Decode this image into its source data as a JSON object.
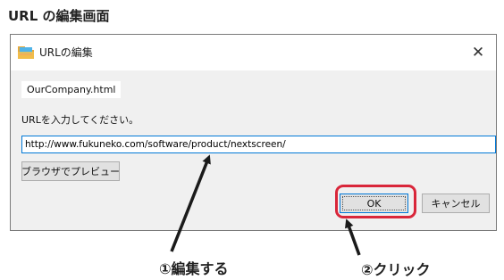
{
  "heading": "URL の編集画面",
  "dialog": {
    "title": "URLの編集",
    "close_glyph": "✕",
    "filename": "OurCompany.html",
    "url_label": "URLを入力してください。",
    "url_value": "http://www.fukuneko.com/software/product/nextscreen/",
    "preview_label": "ブラウザでプレビュー",
    "ok_label": "OK",
    "cancel_label": "キャンセル"
  },
  "annotations": {
    "edit_callout": "①編集する",
    "click_callout": "②クリック",
    "highlight_color": "#d9263a"
  },
  "icons": {
    "app": "app-icon",
    "close": "close-icon",
    "arrow": "arrow-icon"
  }
}
